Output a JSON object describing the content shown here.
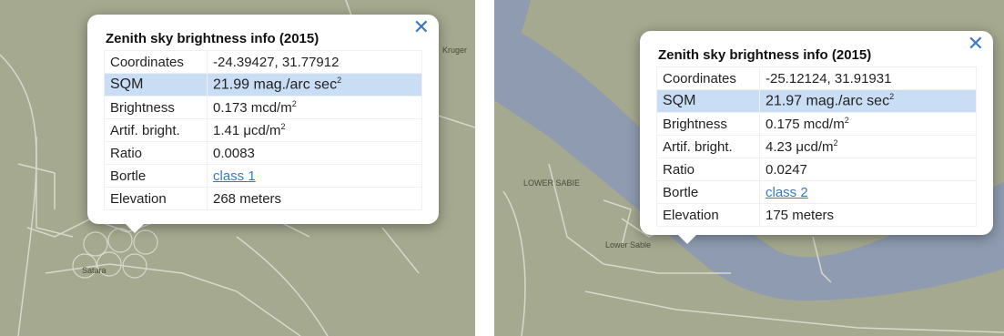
{
  "popups": [
    {
      "title": "Zenith sky brightness info (2015)",
      "close_glyph": "✕",
      "rows": {
        "coordinates": {
          "label": "Coordinates",
          "value": "-24.39427, 31.77912"
        },
        "sqm": {
          "label": "SQM",
          "value": "21.99 mag./arc sec",
          "sup": "2"
        },
        "brightness": {
          "label": "Brightness",
          "value": "0.173 mcd/m",
          "sup": "2"
        },
        "artif": {
          "label": "Artif. bright.",
          "value": "1.41 μcd/m",
          "sup": "2"
        },
        "ratio": {
          "label": "Ratio",
          "value": "0.0083"
        },
        "bortle": {
          "label": "Bortle",
          "value": "class 1"
        },
        "elevation": {
          "label": "Elevation",
          "value": "268 meters"
        }
      },
      "map_labels": {
        "place_1": "Satara",
        "place_2": "Kruger"
      }
    },
    {
      "title": "Zenith sky brightness info (2015)",
      "close_glyph": "✕",
      "rows": {
        "coordinates": {
          "label": "Coordinates",
          "value": "-25.12124, 31.91931"
        },
        "sqm": {
          "label": "SQM",
          "value": "21.97 mag./arc sec",
          "sup": "2"
        },
        "brightness": {
          "label": "Brightness",
          "value": "0.175 mcd/m",
          "sup": "2"
        },
        "artif": {
          "label": "Artif. bright.",
          "value": "4.23 μcd/m",
          "sup": "2"
        },
        "ratio": {
          "label": "Ratio",
          "value": "0.0247"
        },
        "bortle": {
          "label": "Bortle",
          "value": "class 2"
        },
        "elevation": {
          "label": "Elevation",
          "value": "175 meters"
        }
      },
      "map_labels": {
        "place_1": "Lower Sable",
        "place_2": "LOWER SABIE"
      }
    }
  ],
  "colors": {
    "map_land": "#a4a98f",
    "map_land_light": "#b5b8a0",
    "river": "#8e9bb0",
    "road": "#d8d8cc",
    "highlight_row": "#c9def5",
    "link": "#3a78c4"
  }
}
